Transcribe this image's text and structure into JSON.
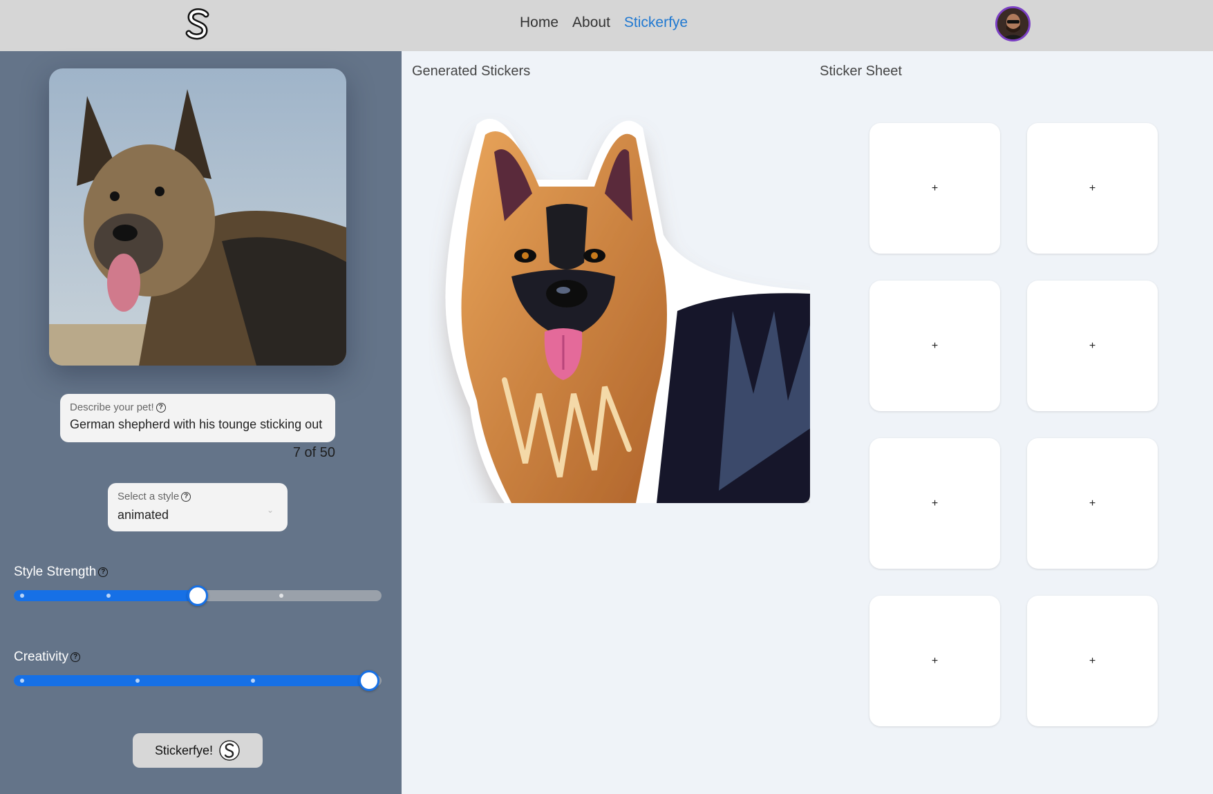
{
  "header": {
    "logo_letter": "S",
    "nav": [
      {
        "label": "Home",
        "active": false
      },
      {
        "label": "About",
        "active": false
      },
      {
        "label": "Stickerfye",
        "active": true
      }
    ],
    "active_color": "#1f78d1"
  },
  "sidebar": {
    "describe": {
      "label": "Describe your pet!",
      "value": "German shepherd with his tounge sticking out",
      "counter": "7 of 50"
    },
    "style_select": {
      "label": "Select a style",
      "value": "animated"
    },
    "style_strength": {
      "label": "Style Strength",
      "value_fraction": 0.5
    },
    "creativity": {
      "label": "Creativity",
      "value_fraction": 1.0
    },
    "submit_label": "Stickerfye!"
  },
  "main": {
    "generated_title": "Generated Stickers",
    "sheet_title": "Sticker Sheet",
    "sheet_slots": [
      "+",
      "+",
      "+",
      "+",
      "+",
      "+",
      "+",
      "+"
    ]
  },
  "colors": {
    "sidebar_bg": "#647489",
    "slider_blue": "#1670e6",
    "avatar_ring": "#7b3fc4"
  }
}
